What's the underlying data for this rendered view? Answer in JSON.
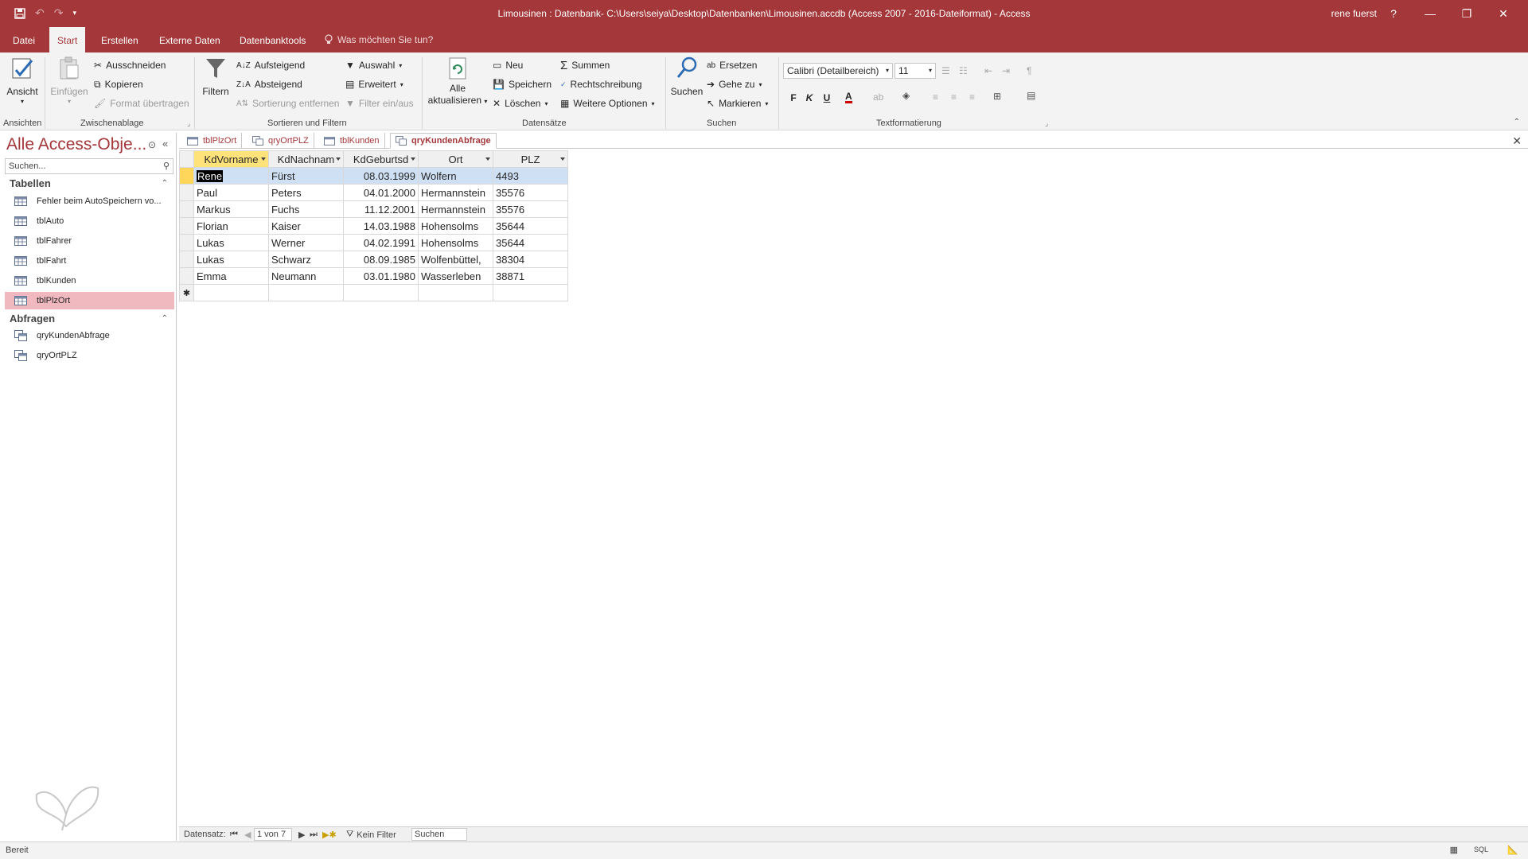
{
  "window": {
    "title": "Limousinen : Datenbank- C:\\Users\\seiya\\Desktop\\Datenbanken\\Limousinen.accdb (Access 2007 - 2016-Dateiformat)  -  Access",
    "user": "rene fuerst",
    "help": "?"
  },
  "menu": {
    "tabs": [
      "Datei",
      "Start",
      "Erstellen",
      "Externe Daten",
      "Datenbanktools"
    ],
    "tell_me": "Was möchten Sie tun?"
  },
  "ribbon": {
    "ansichten": {
      "label": "Ansichten",
      "ansicht": "Ansicht"
    },
    "zwischenablage": {
      "label": "Zwischenablage",
      "einfuegen": "Einfügen",
      "ausschneiden": "Ausschneiden",
      "kopieren": "Kopieren",
      "format": "Format übertragen"
    },
    "sortieren": {
      "label": "Sortieren und Filtern",
      "filtern": "Filtern",
      "aufsteigend": "Aufsteigend",
      "absteigend": "Absteigend",
      "sortierung_entfernen": "Sortierung entfernen",
      "auswahl": "Auswahl",
      "erweitert": "Erweitert",
      "filter_ein_aus": "Filter ein/aus"
    },
    "datensaetze": {
      "label": "Datensätze",
      "alle": "Alle",
      "aktualisieren": "aktualisieren",
      "neu": "Neu",
      "speichern": "Speichern",
      "loeschen": "Löschen",
      "summen": "Summen",
      "rechtschreibung": "Rechtschreibung",
      "weitere": "Weitere Optionen"
    },
    "suchen": {
      "label": "Suchen",
      "suchen": "Suchen",
      "ersetzen": "Ersetzen",
      "gehe_zu": "Gehe zu",
      "markieren": "Markieren"
    },
    "text": {
      "label": "Textformatierung",
      "font": "Calibri (Detailbereich)",
      "size": "11",
      "bold": "F",
      "italic": "K",
      "underline": "U"
    }
  },
  "nav": {
    "title": "Alle Access-Obje...",
    "search_placeholder": "Suchen...",
    "sections": [
      {
        "label": "Tabellen",
        "items": [
          "Fehler beim AutoSpeichern vo...",
          "tblAuto",
          "tblFahrer",
          "tblFahrt",
          "tblKunden",
          "tblPlzOrt"
        ]
      },
      {
        "label": "Abfragen",
        "items": [
          "qryKundenAbfrage",
          "qryOrtPLZ"
        ]
      }
    ]
  },
  "doc_tabs": [
    "tblPlzOrt",
    "qryOrtPLZ",
    "tblKunden",
    "qryKundenAbfrage"
  ],
  "grid": {
    "columns": [
      "KdVorname",
      "KdNachnam",
      "KdGeburtsd",
      "Ort",
      "PLZ"
    ],
    "rows": [
      [
        "Rene",
        "Fürst",
        "08.03.1999",
        "Wolfern",
        "4493"
      ],
      [
        "Paul",
        "Peters",
        "04.01.2000",
        "Hermannstein",
        "35576"
      ],
      [
        "Markus",
        "Fuchs",
        "11.12.2001",
        "Hermannstein",
        "35576"
      ],
      [
        "Florian",
        "Kaiser",
        "14.03.1988",
        "Hohensolms",
        "35644"
      ],
      [
        "Lukas",
        "Werner",
        "04.02.1991",
        "Hohensolms",
        "35644"
      ],
      [
        "Lukas",
        "Schwarz",
        "08.09.1985",
        "Wolfenbüttel,",
        "38304"
      ],
      [
        "Emma",
        "Neumann",
        "03.01.1980",
        "Wasserleben",
        "38871"
      ]
    ],
    "new_row_marker": "✱"
  },
  "recnav": {
    "label": "Datensatz:",
    "position": "1 von 7",
    "filter": "Kein Filter",
    "search": "Suchen"
  },
  "status": {
    "text": "Bereit",
    "sql": "SQL"
  },
  "colors": {
    "accent": "#a4373a",
    "selected_nav": "#f0b8bf",
    "active_header": "#ffe27a"
  }
}
